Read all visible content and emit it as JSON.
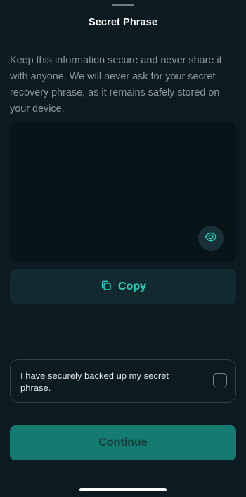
{
  "screen": {
    "title": "Secret Phrase",
    "description": "Keep this information secure and never share it with anyone. We will never ask for your secret recovery phrase, as it remains safely stored on your device."
  },
  "phrase": {
    "hidden": true,
    "words": [
      {
        "num": "",
        "word": ""
      },
      {
        "num": "",
        "word": ""
      },
      {
        "num": "",
        "word": ""
      },
      {
        "num": "",
        "word": ""
      },
      {
        "num": "",
        "word": ""
      },
      {
        "num": "",
        "word": ""
      },
      {
        "num": "",
        "word": ""
      },
      {
        "num": "",
        "word": ""
      },
      {
        "num": "",
        "word": ""
      },
      {
        "num": "",
        "word": ""
      },
      {
        "num": "",
        "word": ""
      },
      {
        "num": "",
        "word": ""
      }
    ],
    "reveal_icon": "eye-icon"
  },
  "copy_button": {
    "label": "Copy",
    "icon": "copy-icon"
  },
  "backup_confirmation": {
    "label": "I have securely backed up my secret phrase.",
    "checked": false
  },
  "continue_button": {
    "label": "Continue"
  },
  "colors": {
    "background": "#0b1b21",
    "accent": "#2ad3bb",
    "continue": "#157a70"
  }
}
